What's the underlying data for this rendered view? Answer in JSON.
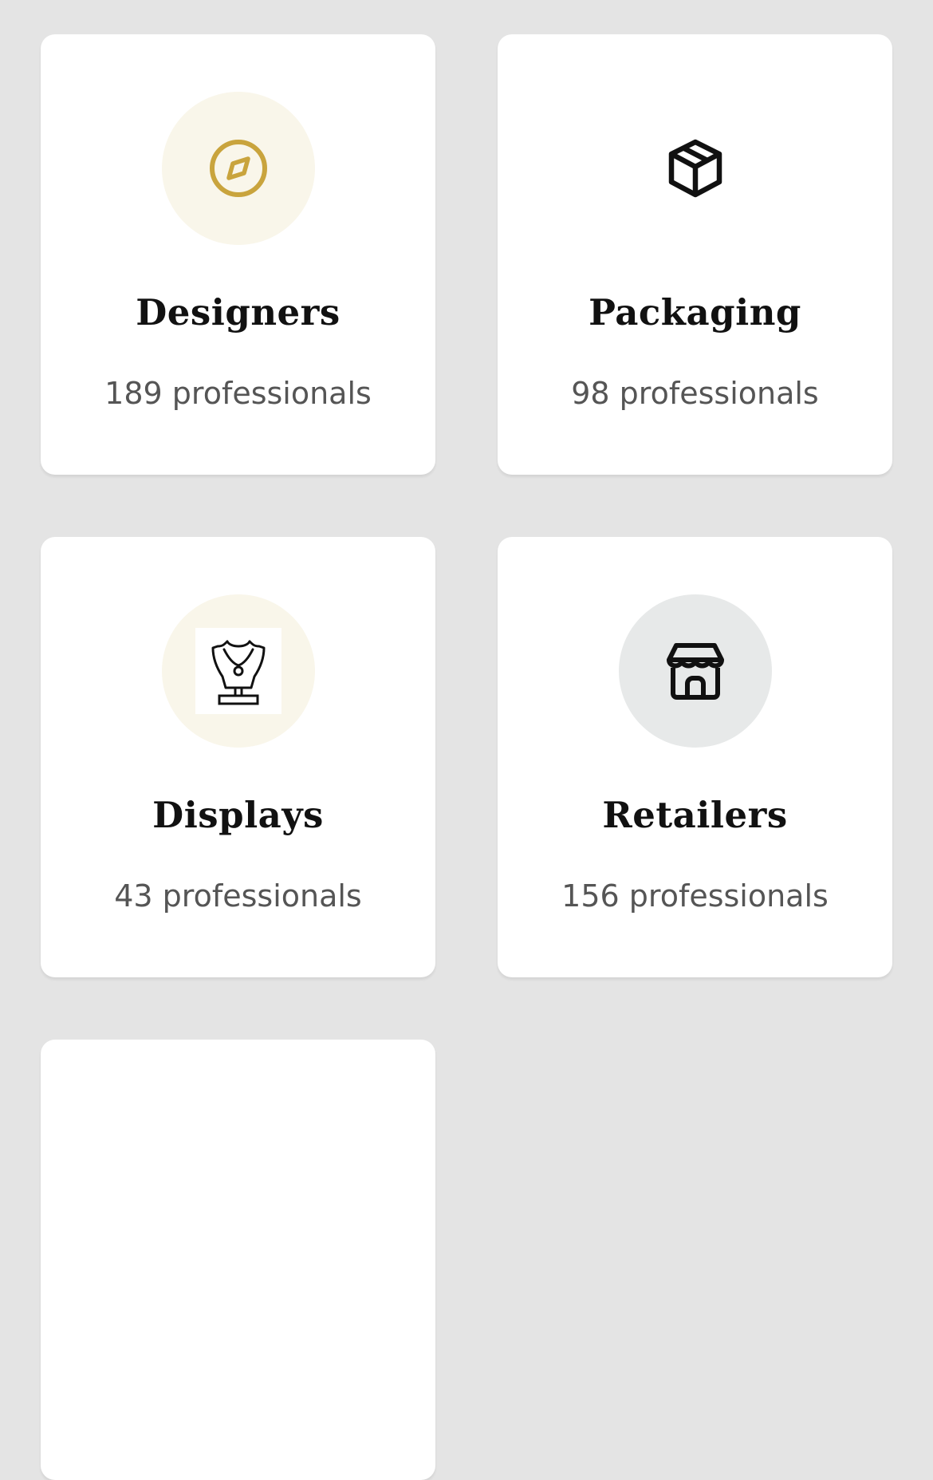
{
  "categories": [
    {
      "id": "designers",
      "title": "Designers",
      "count": "189 professionals",
      "icon": "compass-icon",
      "icon_color": "#c9a43d",
      "circle_color": "#f9f6ea"
    },
    {
      "id": "packaging",
      "title": "Packaging",
      "count": "98 professionals",
      "icon": "package-box-icon",
      "icon_color": "#111111"
    },
    {
      "id": "displays",
      "title": "Displays",
      "count": "43 professionals",
      "icon": "necklace-bust-icon",
      "icon_color": "#111111",
      "circle_color": "#f9f6ea"
    },
    {
      "id": "retailers",
      "title": "Retailers",
      "count": "156 professionals",
      "icon": "storefront-icon",
      "icon_color": "#111111",
      "circle_color": "#e7e9e9"
    }
  ]
}
